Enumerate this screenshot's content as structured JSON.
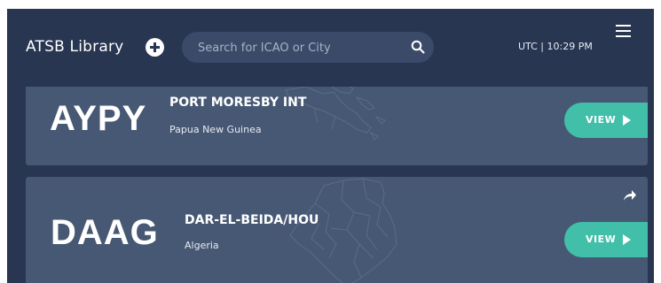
{
  "header": {
    "title": "ATSB Library",
    "add_icon": "plus-circle-icon",
    "search": {
      "placeholder": "Search for ICAO or City",
      "value": "",
      "icon": "search-icon"
    },
    "time": "UTC | 10:29 PM",
    "menu_icon": "hamburger-menu-icon"
  },
  "airports": [
    {
      "icao": "AYPY",
      "name": "PORT MORESBY INT",
      "country": "Papua New Guinea",
      "view_label": "VIEW",
      "view_icon": "play-icon"
    },
    {
      "icao": "DAAG",
      "name": "DAR-EL-BEIDA/HOU",
      "country": "Algeria",
      "view_label": "VIEW",
      "view_icon": "play-icon",
      "share_icon": "share-arrow-icon"
    }
  ],
  "colors": {
    "background": "#283652",
    "card": "#475874",
    "accent": "#41bfa9",
    "search": "#3a4a68"
  }
}
